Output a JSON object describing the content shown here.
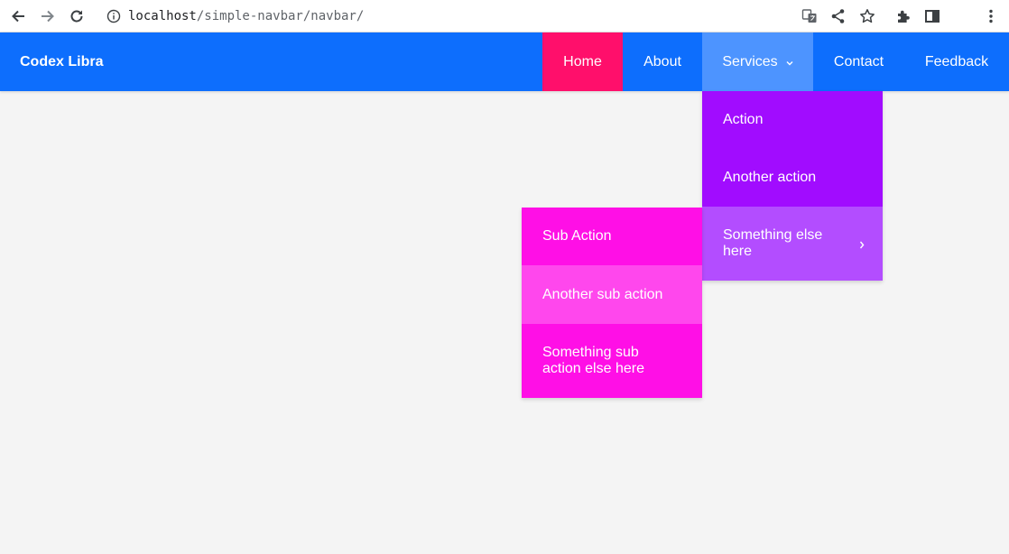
{
  "browser": {
    "url_host": "localhost",
    "url_path": "/simple-navbar/navbar/"
  },
  "navbar": {
    "brand": "Codex Libra",
    "items": [
      {
        "label": "Home"
      },
      {
        "label": "About"
      },
      {
        "label": "Services"
      },
      {
        "label": "Contact"
      },
      {
        "label": "Feedback"
      }
    ],
    "colors": {
      "bar": "#0d6efd",
      "home_active": "#ff0f6b",
      "services_open": "#4d94ff"
    }
  },
  "services_dropdown": {
    "items": [
      {
        "label": "Action"
      },
      {
        "label": "Another action"
      },
      {
        "label": "Something else here"
      }
    ],
    "colors": {
      "item": "#a10cff",
      "hover": "#b34dff"
    }
  },
  "submenu": {
    "items": [
      {
        "label": "Sub Action"
      },
      {
        "label": "Another sub action"
      },
      {
        "label": "Something sub action else here"
      }
    ],
    "colors": {
      "item": "#ff0fe6",
      "hover": "#ff47ed"
    }
  },
  "icons": [
    "back-icon",
    "forward-icon",
    "reload-icon",
    "info-icon",
    "translate-icon",
    "share-icon",
    "star-icon",
    "extensions-icon",
    "side-panel-icon",
    "menu-icon",
    "chevron-down-icon",
    "chevron-right-icon"
  ]
}
